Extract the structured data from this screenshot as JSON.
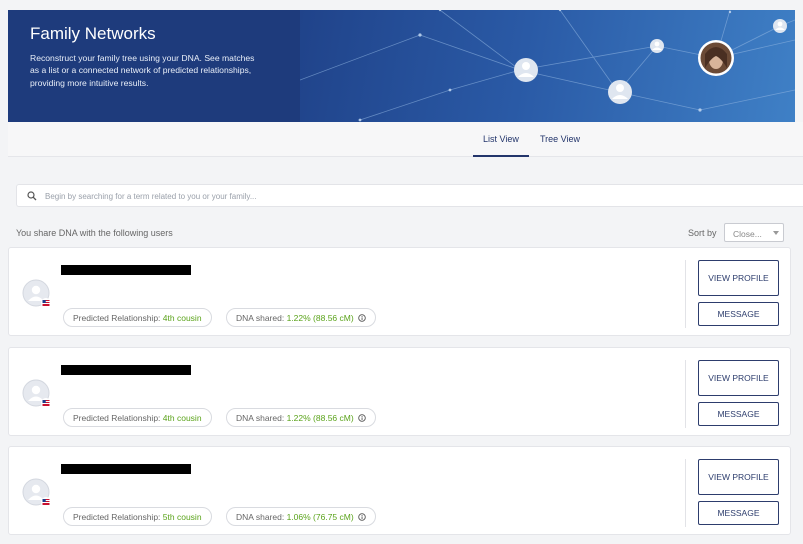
{
  "hero": {
    "title": "Family Networks",
    "description": "Reconstruct your family tree using your DNA. See matches as a list or a connected network of predicted relationships, providing more intuitive results."
  },
  "tabs": [
    {
      "label": "List View",
      "active": true
    },
    {
      "label": "Tree View",
      "active": false
    }
  ],
  "search": {
    "placeholder": "Begin by searching for a term related to you or your family..."
  },
  "list_header": {
    "share_text": "You share DNA with the following users",
    "sort_label": "Sort by",
    "sort_value": "Close..."
  },
  "matches": [
    {
      "relationship_label": "Predicted Relationship:",
      "relationship_value": "4th cousin",
      "dna_label": "DNA shared:",
      "dna_value": "1.22% (88.56 cM)",
      "view_label": "View Profile",
      "message_label": "Message"
    },
    {
      "relationship_label": "Predicted Relationship:",
      "relationship_value": "4th cousin",
      "dna_label": "DNA shared:",
      "dna_value": "1.22% (88.56 cM)",
      "view_label": "View Profile",
      "message_label": "Message"
    },
    {
      "relationship_label": "Predicted Relationship:",
      "relationship_value": "5th cousin",
      "dna_label": "DNA shared:",
      "dna_value": "1.06% (76.75 cM)",
      "view_label": "View Profile",
      "message_label": "Message"
    }
  ],
  "icons": {
    "search": "search-icon",
    "info": "info-icon",
    "flag": "us-flag-icon",
    "avatar": "default-avatar-icon"
  },
  "colors": {
    "hero_bg": "#1e3b7c",
    "accent": "#23356b",
    "green": "#5aa31a"
  }
}
